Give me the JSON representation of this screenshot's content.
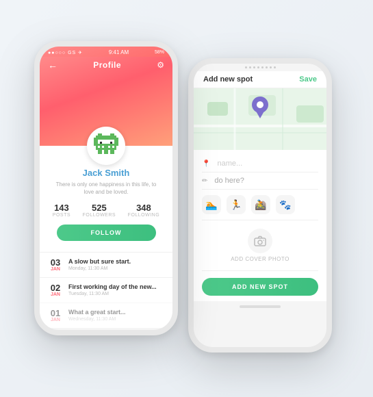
{
  "leftPhone": {
    "statusBar": {
      "signal": "●●○○○",
      "carrier": "GS",
      "time": "9:41 AM",
      "battery": "58%"
    },
    "header": {
      "title": "Profile",
      "backLabel": "←",
      "settingsIcon": "⚙"
    },
    "profile": {
      "name": "Jack Smith",
      "bio": "There is only one happiness in this life, to love and be loved.",
      "stats": [
        {
          "value": "143",
          "label": "POSTS"
        },
        {
          "value": "525",
          "label": "FOLLOWERS"
        },
        {
          "value": "348",
          "label": "FOLLOWING"
        }
      ],
      "followButton": "FOLLOW"
    },
    "feed": [
      {
        "day": "03",
        "month": "JAN",
        "title": "A slow but sure start.",
        "time": "Monday, 11:30 AM"
      },
      {
        "day": "02",
        "month": "JAN",
        "title": "First working day of the new...",
        "time": "Tuesday, 11:30 AM"
      },
      {
        "day": "01",
        "month": "JAN",
        "title": "What a great start...",
        "time": "Wednesday, 11:30 AM"
      }
    ]
  },
  "rightPhone": {
    "statusDots": "............",
    "header": {
      "title": "Add new spot",
      "saveLabel": "Save"
    },
    "form": {
      "namePlaceholder": "name...",
      "doPlaceholder": "do here?",
      "activities": [
        "🏊",
        "🏃",
        "🚵",
        "🐾"
      ],
      "coverPhotoLabel": "ADD COVER PHOTO",
      "addSpotButton": "ADD NEW SPOT"
    }
  }
}
